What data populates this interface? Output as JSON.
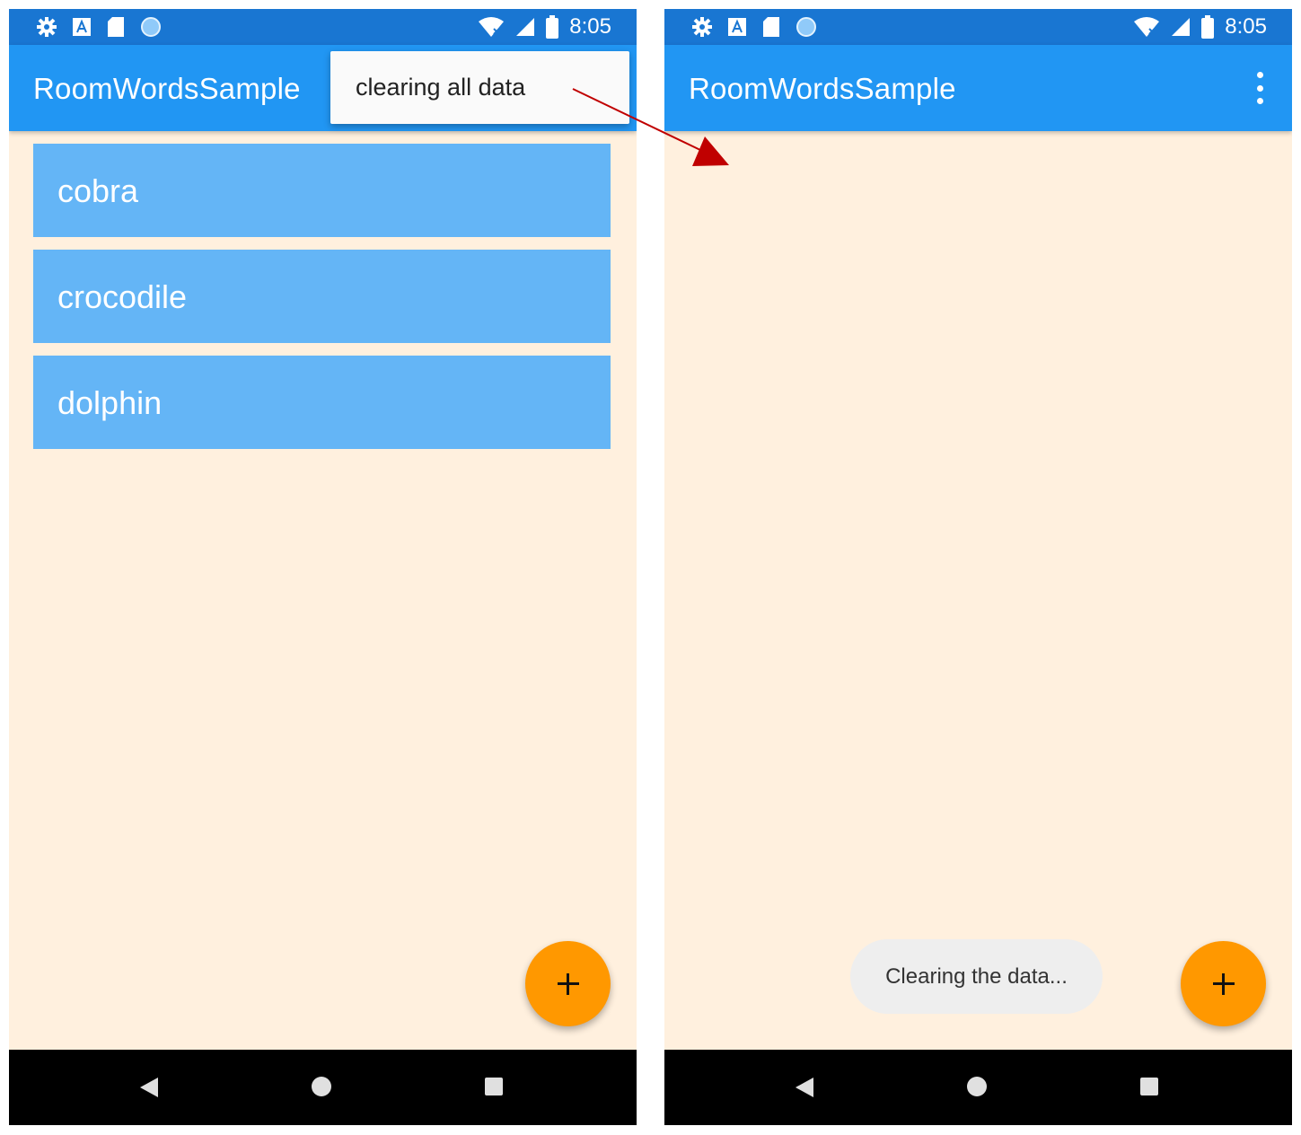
{
  "left_screen": {
    "status_bar": {
      "time": "8:05",
      "icons": [
        "gear-icon",
        "a-icon",
        "sd-card-icon",
        "circle-icon",
        "wifi-icon",
        "signal-icon",
        "battery-icon"
      ]
    },
    "app_bar": {
      "title": "RoomWordsSample"
    },
    "popup_menu": {
      "items": [
        {
          "label": "clearing all data"
        }
      ]
    },
    "word_list": {
      "items": [
        {
          "word": "cobra"
        },
        {
          "word": "crocodile"
        },
        {
          "word": "dolphin"
        }
      ]
    },
    "fab": {
      "icon": "plus-icon"
    }
  },
  "right_screen": {
    "status_bar": {
      "time": "8:05",
      "icons": [
        "gear-icon",
        "a-icon",
        "sd-card-icon",
        "circle-icon",
        "wifi-icon",
        "signal-icon",
        "battery-icon"
      ]
    },
    "app_bar": {
      "title": "RoomWordsSample",
      "overflow_icon": "more-vert-icon"
    },
    "toast": {
      "message": "Clearing the data..."
    },
    "fab": {
      "icon": "plus-icon"
    }
  },
  "colors": {
    "status_bar": "#1976d2",
    "app_bar": "#2196f3",
    "background": "#fff0de",
    "list_item": "#64b5f6",
    "fab": "#ff9800",
    "arrow": "#c00000"
  }
}
